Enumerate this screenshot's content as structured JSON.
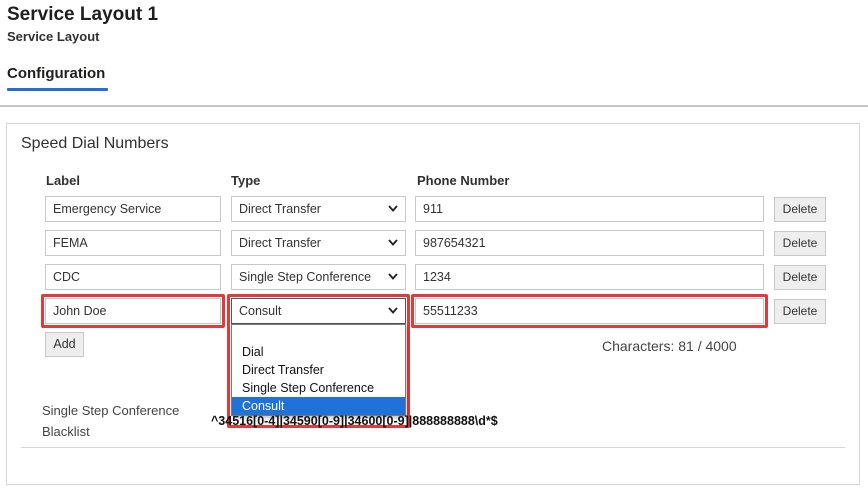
{
  "header": {
    "title": "Service Layout 1",
    "subtitle": "Service Layout",
    "tab": "Configuration",
    "accent_color": "#2a6ad6"
  },
  "section": {
    "title": "Speed Dial Numbers",
    "columns": {
      "label": "Label",
      "type": "Type",
      "phone": "Phone Number"
    },
    "rows": [
      {
        "label": "Emergency Service",
        "type": "Direct Transfer",
        "phone": "911",
        "delete": "Delete"
      },
      {
        "label": "FEMA",
        "type": "Direct Transfer",
        "phone": "987654321",
        "delete": "Delete"
      },
      {
        "label": "CDC",
        "type": "Single Step Conference",
        "phone": "1234",
        "delete": "Delete"
      },
      {
        "label": "John Doe",
        "type": "Consult",
        "phone": "55511233",
        "delete": "Delete",
        "highlighted": true
      }
    ],
    "add_label": "Add",
    "char_count": "Characters: 81 / 4000",
    "dropdown": {
      "options": [
        "",
        "Dial",
        "Direct Transfer",
        "Single Step Conference",
        "Consult"
      ],
      "selected": "Consult"
    },
    "blacklist": {
      "label": "Single Step Conference Blacklist",
      "value": "^34516[0-4]|34590[0-9]|34600[0-9]|888888888\\d*$"
    },
    "highlight_color": "#e03b3b"
  }
}
